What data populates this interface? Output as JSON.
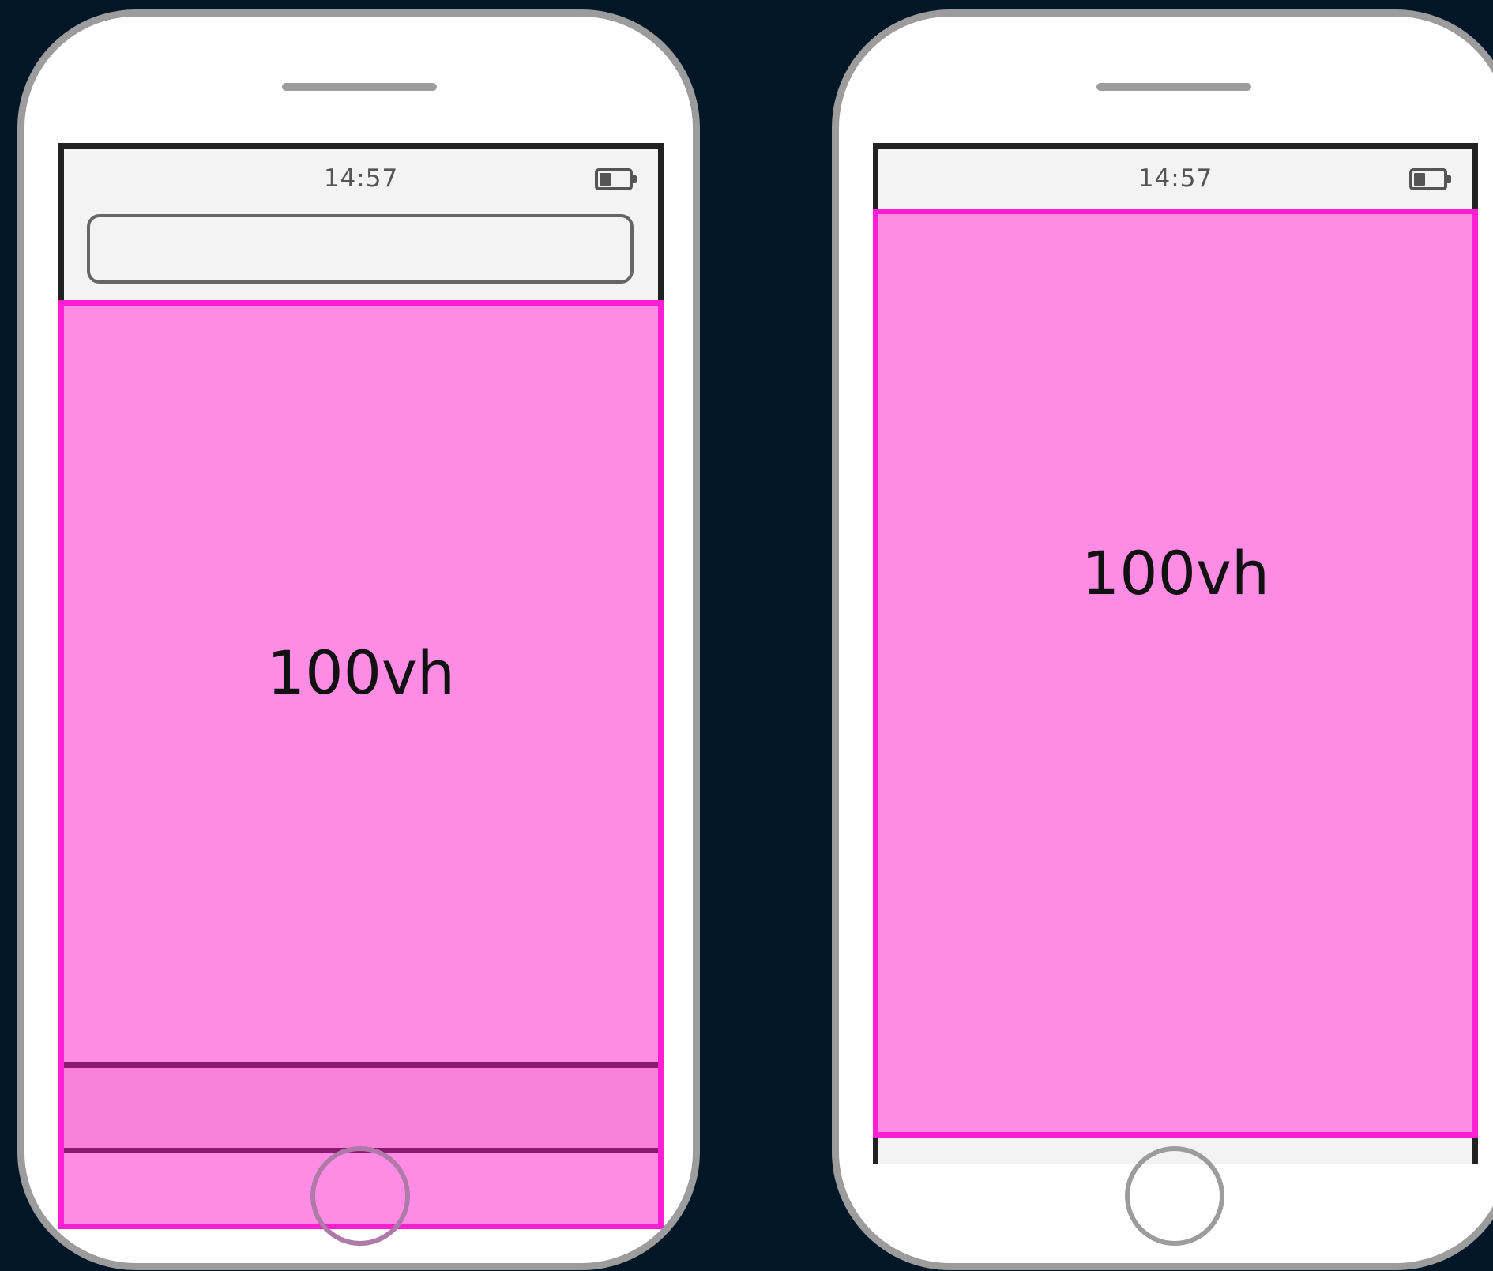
{
  "phones": [
    {
      "id": "left",
      "status_time": "14:57",
      "viewport_label": "100vh",
      "has_url_bar": true,
      "has_bottom_toolbar": true
    },
    {
      "id": "right",
      "status_time": "14:57",
      "viewport_label": "100vh",
      "has_url_bar": false,
      "has_bottom_toolbar": false
    }
  ],
  "colors": {
    "background": "#011627",
    "viewport_fill": "#ff8ce4",
    "viewport_border": "#ff1fd2",
    "toolbar_line": "#8a1a70",
    "phone_frame": "#9c9c9c"
  },
  "icons": [
    "battery-icon",
    "speaker-grille",
    "home-button"
  ]
}
